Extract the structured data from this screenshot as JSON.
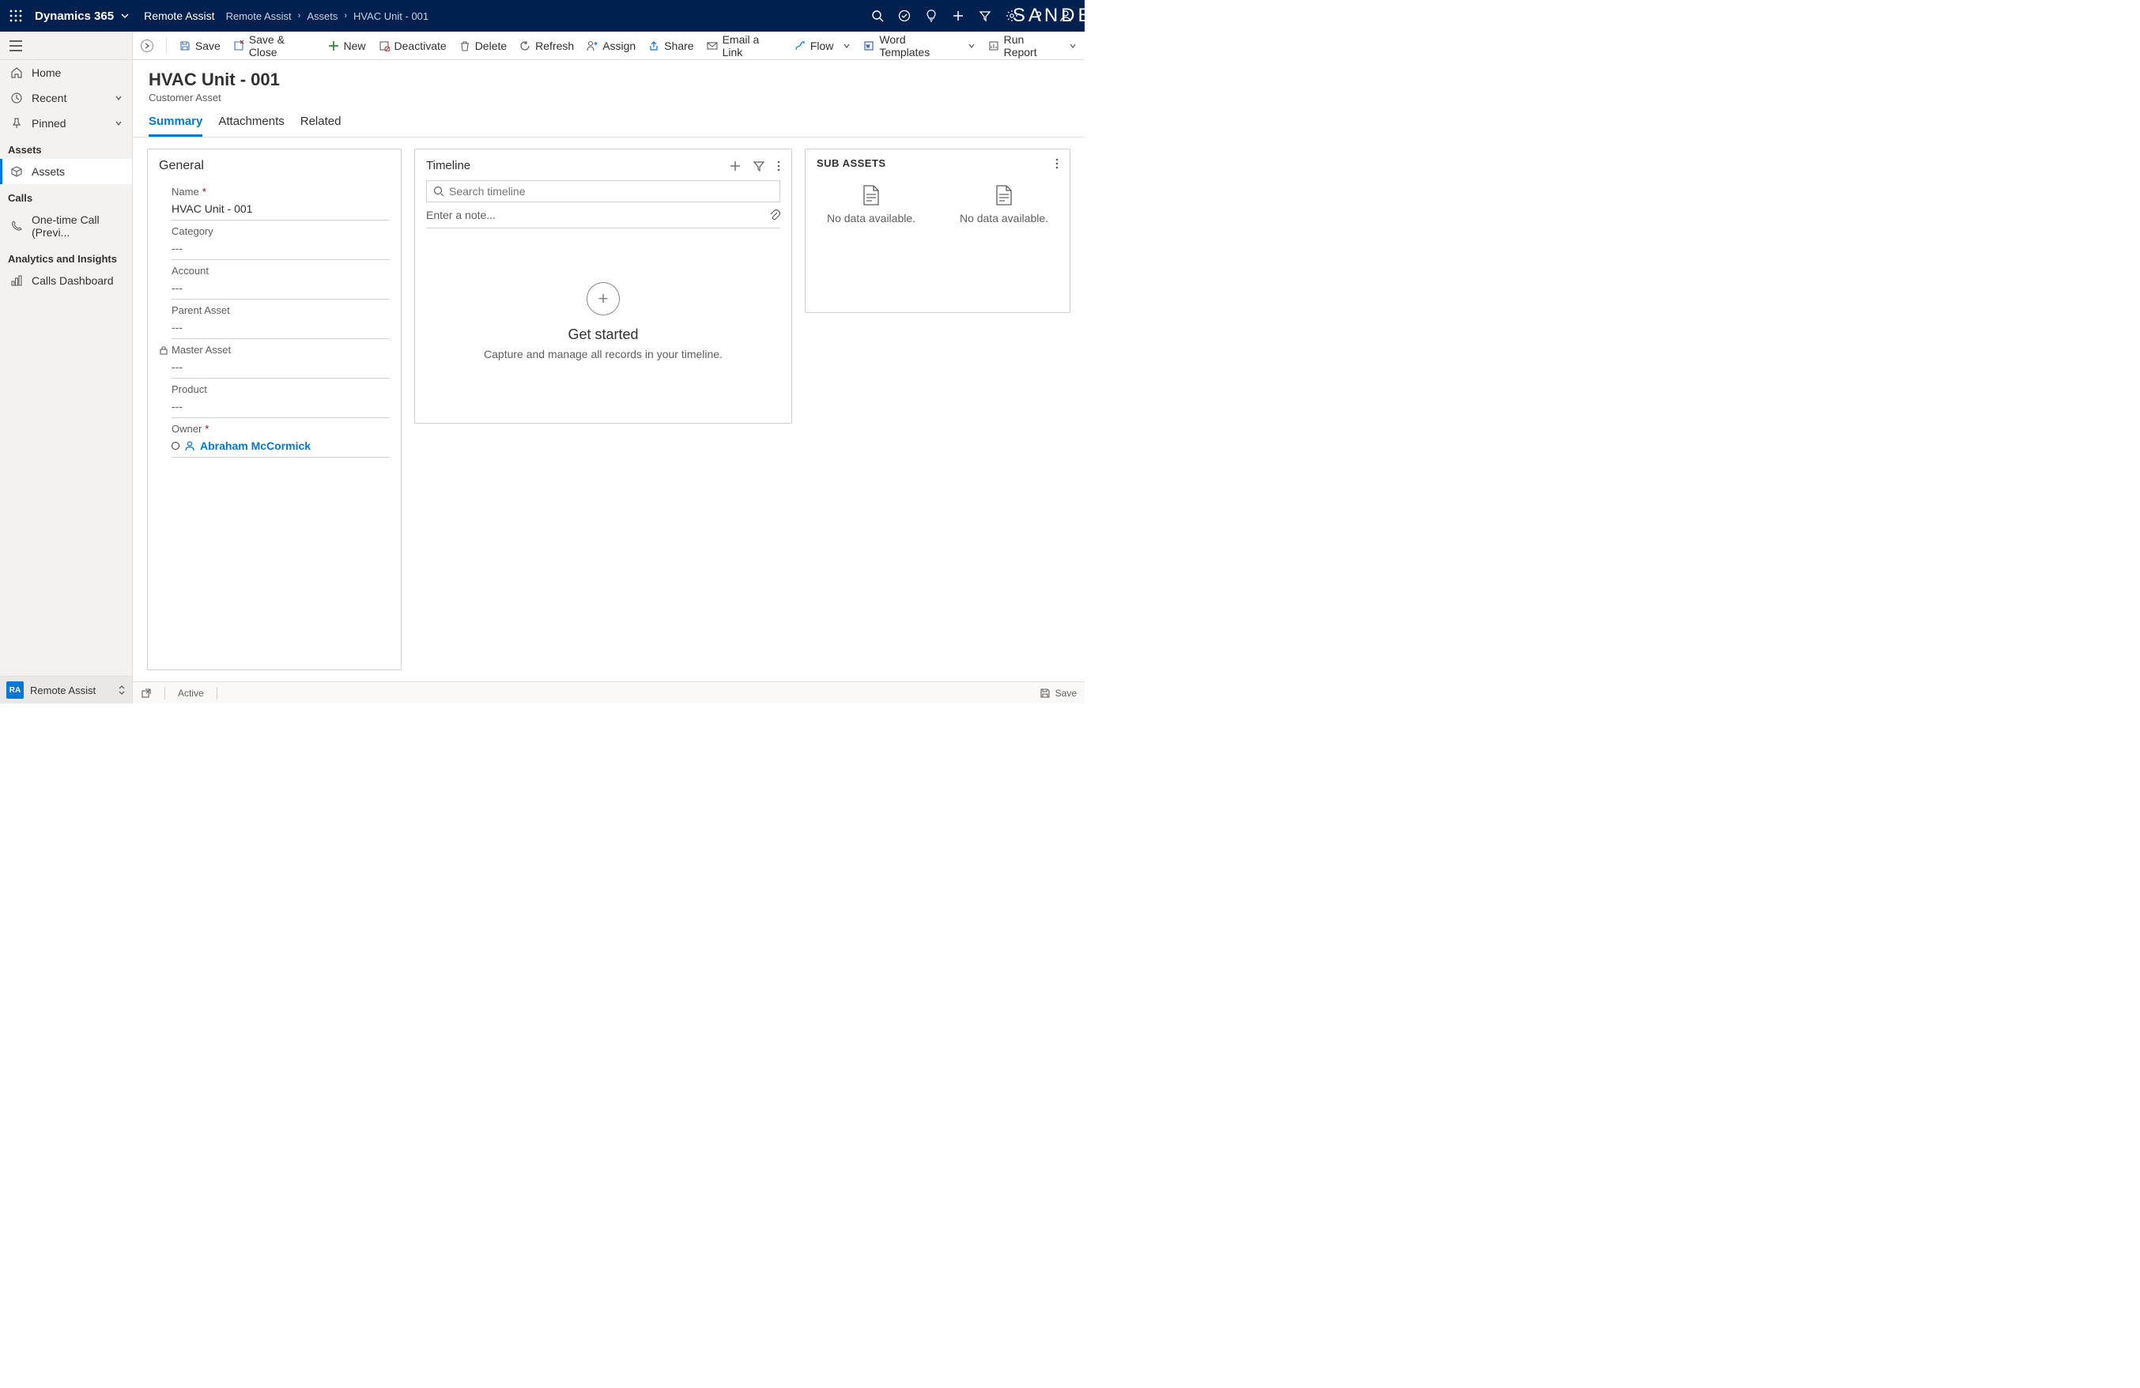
{
  "header": {
    "app_name": "Dynamics 365",
    "context": "Remote Assist",
    "breadcrumb": [
      "Remote Assist",
      "Assets",
      "HVAC Unit - 001"
    ],
    "sandbox": "SANDBOX"
  },
  "sidebar": {
    "home": "Home",
    "recent": "Recent",
    "pinned": "Pinned",
    "sections": {
      "assets": {
        "title": "Assets",
        "item": "Assets"
      },
      "calls": {
        "title": "Calls",
        "item": "One-time Call (Previ..."
      },
      "analytics": {
        "title": "Analytics and Insights",
        "item": "Calls Dashboard"
      }
    },
    "footer": {
      "badge": "RA",
      "label": "Remote Assist"
    }
  },
  "commands": {
    "save": "Save",
    "save_close": "Save & Close",
    "new": "New",
    "deactivate": "Deactivate",
    "delete": "Delete",
    "refresh": "Refresh",
    "assign": "Assign",
    "share": "Share",
    "email": "Email a Link",
    "flow": "Flow",
    "word": "Word Templates",
    "report": "Run Report"
  },
  "page": {
    "title": "HVAC Unit - 001",
    "subtype": "Customer Asset"
  },
  "tabs": {
    "summary": "Summary",
    "attachments": "Attachments",
    "related": "Related"
  },
  "general": {
    "title": "General",
    "name_label": "Name",
    "name_value": "HVAC Unit - 001",
    "category_label": "Category",
    "category_value": "---",
    "account_label": "Account",
    "account_value": "---",
    "parent_label": "Parent Asset",
    "parent_value": "---",
    "master_label": "Master Asset",
    "master_value": "---",
    "product_label": "Product",
    "product_value": "---",
    "owner_label": "Owner",
    "owner_value": "Abraham McCormick"
  },
  "timeline": {
    "title": "Timeline",
    "search_placeholder": "Search timeline",
    "note_placeholder": "Enter a note...",
    "empty_title": "Get started",
    "empty_sub": "Capture and manage all records in your timeline."
  },
  "sub": {
    "title": "SUB ASSETS",
    "no_data": "No data available."
  },
  "status": {
    "state": "Active",
    "save": "Save"
  }
}
